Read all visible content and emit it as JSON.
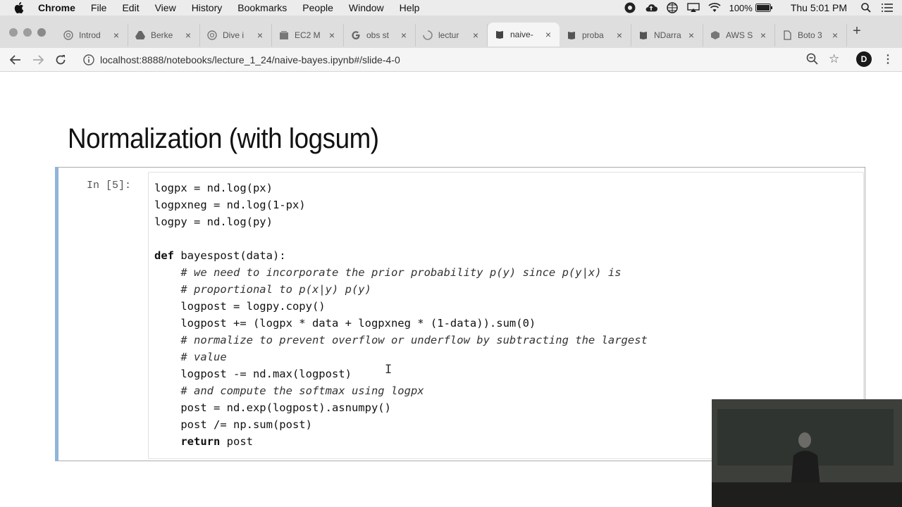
{
  "menubar": {
    "app_name": "Chrome",
    "items": [
      "File",
      "Edit",
      "View",
      "History",
      "Bookmarks",
      "People",
      "Window",
      "Help"
    ],
    "battery": "100%",
    "clock": "Thu 5:01 PM"
  },
  "tabs": [
    {
      "title": "Introd",
      "icon": "globe-icon"
    },
    {
      "title": "Berke",
      "icon": "drive-icon"
    },
    {
      "title": "Dive i",
      "icon": "globe-icon"
    },
    {
      "title": "EC2 M",
      "icon": "box-icon"
    },
    {
      "title": "obs st",
      "icon": "google-icon"
    },
    {
      "title": "lectur",
      "icon": "loading-icon"
    },
    {
      "title": "naive-",
      "icon": "notebook-icon"
    },
    {
      "title": "proba",
      "icon": "notebook-icon"
    },
    {
      "title": "NDarra",
      "icon": "notebook-icon"
    },
    {
      "title": "AWS S",
      "icon": "cube-icon"
    },
    {
      "title": "Boto 3",
      "icon": "page-icon"
    }
  ],
  "address_bar": {
    "url": "localhost:8888/notebooks/lecture_1_24/naive-bayes.ipynb#/slide-4-0"
  },
  "avatar_letter": "D",
  "slide": {
    "title": "Normalization (with logsum)"
  },
  "cell": {
    "prompt": "In [5]:",
    "lines": [
      "logpx = nd.log(px)",
      "logpxneg = nd.log(1-px)",
      "logpy = nd.log(py)",
      "",
      "def bayespost(data):",
      "    # we need to incorporate the prior probability p(y) since p(y|x) is",
      "    # proportional to p(x|y) p(y)",
      "    logpost = logpy.copy()",
      "    logpost += (logpx * data + logpxneg * (1-data)).sum(0)",
      "    # normalize to prevent overflow or underflow by subtracting the largest",
      "    # value",
      "    logpost -= nd.max(logpost)",
      "    # and compute the softmax using logpx",
      "    post = nd.exp(logpost).asnumpy()",
      "    post /= np.sum(post)",
      "    return post"
    ]
  },
  "colors": {
    "cell_border_left": "#8fb5d9",
    "menubar_bg": "#ececec",
    "tabstrip_bg": "#dedede"
  }
}
